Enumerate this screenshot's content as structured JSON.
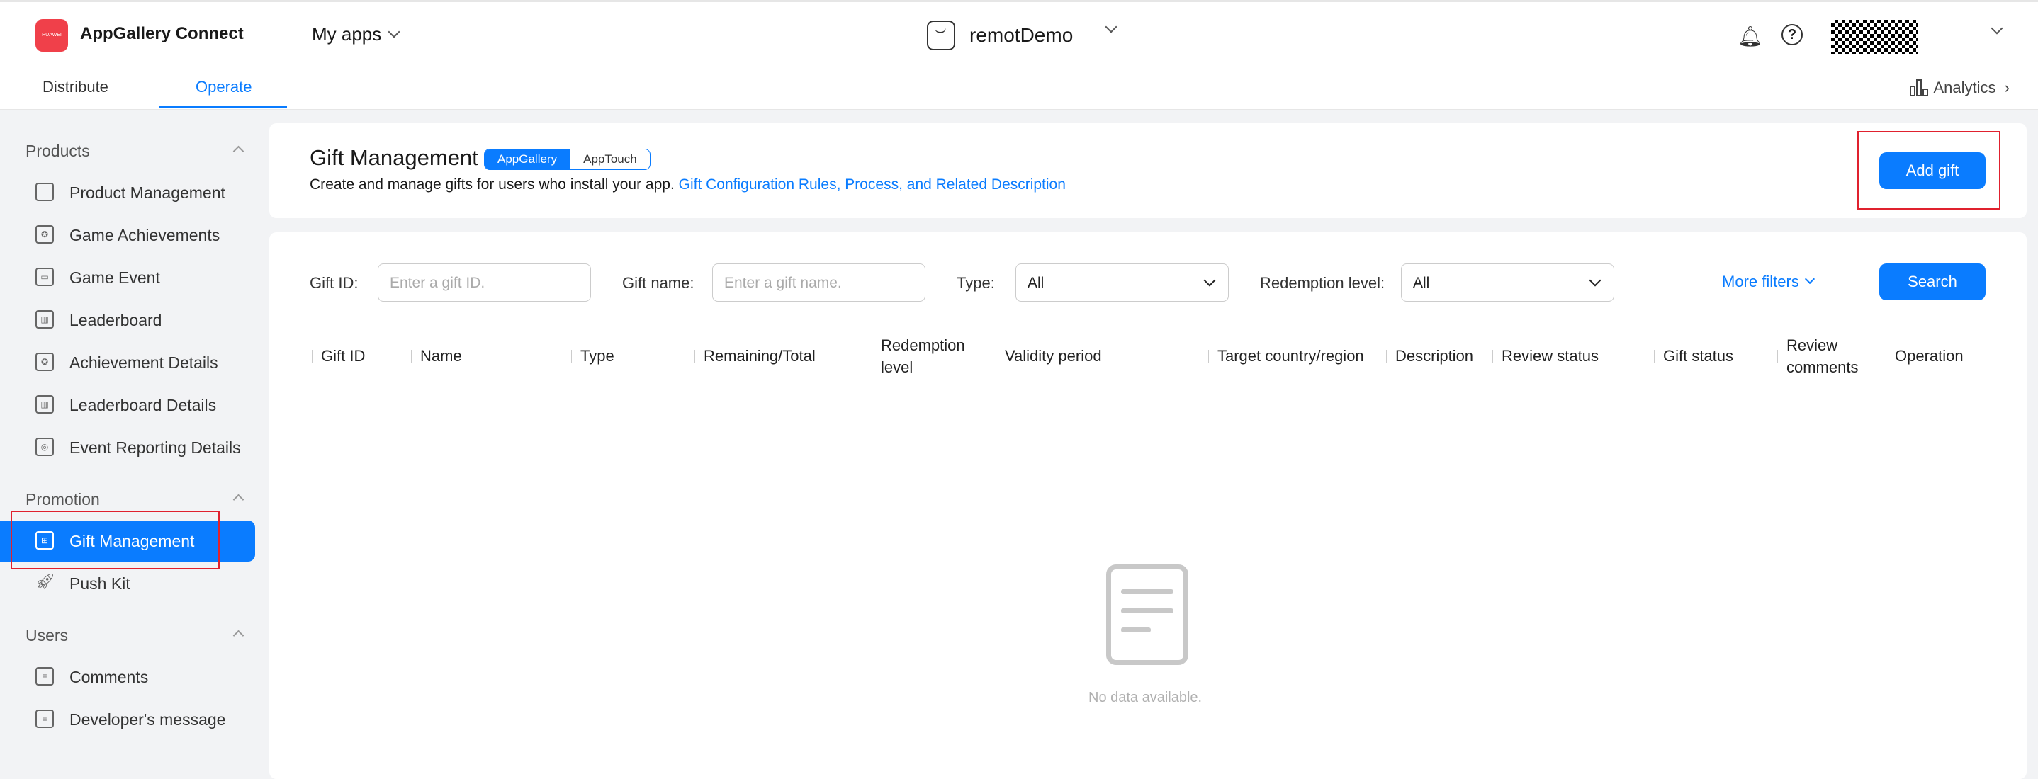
{
  "header": {
    "brand": "AppGallery Connect",
    "logo_text": "HUAWEI",
    "my_apps": "My apps",
    "app_name": "remotDemo"
  },
  "subnav": {
    "tabs": [
      {
        "label": "Distribute",
        "active": false
      },
      {
        "label": "Operate",
        "active": true
      }
    ],
    "analytics": "Analytics"
  },
  "sidebar": {
    "sections": [
      {
        "title": "Products",
        "items": [
          "Product Management",
          "Game Achievements",
          "Game Event",
          "Leaderboard",
          "Achievement Details",
          "Leaderboard Details",
          "Event Reporting Details"
        ]
      },
      {
        "title": "Promotion",
        "items": [
          "Gift Management",
          "Push Kit"
        ]
      },
      {
        "title": "Users",
        "items": [
          "Comments",
          "Developer's message"
        ]
      }
    ],
    "active_item": "Gift Management"
  },
  "page": {
    "title": "Gift Management",
    "segment": [
      "AppGallery",
      "AppTouch"
    ],
    "segment_active": "AppGallery",
    "description": "Create and manage gifts for users who install your app.",
    "link": "Gift Configuration Rules, Process, and Related Description",
    "add_button": "Add gift"
  },
  "filters": {
    "gift_id_label": "Gift ID:",
    "gift_id_placeholder": "Enter a gift ID.",
    "gift_name_label": "Gift name:",
    "gift_name_placeholder": "Enter a gift name.",
    "type_label": "Type:",
    "type_value": "All",
    "redemption_label": "Redemption level:",
    "redemption_value": "All",
    "more_filters": "More filters",
    "search": "Search"
  },
  "table": {
    "columns": [
      "Gift ID",
      "Name",
      "Type",
      "Remaining/Total",
      "Redemption level",
      "Validity period",
      "Target country/region",
      "Description",
      "Review status",
      "Gift status",
      "Review comments",
      "Operation"
    ],
    "empty_text": "No data available."
  },
  "colors": {
    "accent": "#0a7cff",
    "highlight": "#e0212e",
    "brand": "#f0404a"
  }
}
